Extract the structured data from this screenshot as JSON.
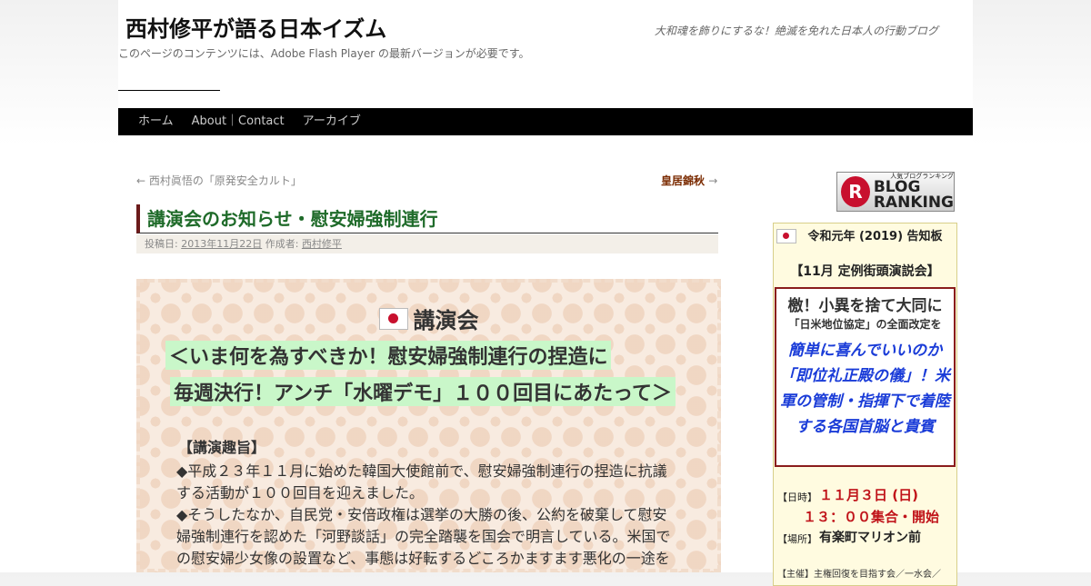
{
  "header": {
    "site_title": "西村修平が語る日本イズム",
    "tagline": "大和魂を飾りにするな！絶滅を免れた日本人の行動ブログ",
    "flash_note": "このページのコンテンツには、Adobe Flash Player の最新バージョンが必要です。"
  },
  "nav": {
    "items": [
      {
        "label": "ホーム"
      },
      {
        "label": "About｜Contact"
      },
      {
        "label": "アーカイブ"
      }
    ]
  },
  "post_nav": {
    "prev": "← 西村眞悟の「原発安全カルト」",
    "next": "皇居錦秋",
    "next_arrow": "→"
  },
  "post": {
    "title": "講演会のお知らせ・慰安婦強制連行",
    "meta_posted_label": "投稿日:",
    "meta_date": "2013年11月22日",
    "meta_author_label": "作成者:",
    "meta_author": "西村修平"
  },
  "content": {
    "heading": "講演会",
    "subtitle1": "＜いま何を為すべきか！慰安婦強制連行の捏造に",
    "subtitle2": "毎週決行！アンチ「水曜デモ」１００回目にあたって＞",
    "section_heading": "【講演趣旨】",
    "paragraphs": [
      "◆平成２３年１１月に始めた韓国大使館前で、慰安婦強制連行の捏造に抗議する活動が１００回目を迎えました。",
      "◆そうしたなか、自民党・安倍政権は選挙の大勝の後、公約を破棄して慰安婦強制連行を認めた「河野談話」の完全踏襲を国会で明言している。米国での慰安婦少女像の設置など、事態は好転するどころかますます悪化の一途を"
    ]
  },
  "banner": {
    "circle": "R",
    "small": "人気ブログランキング",
    "line1": "BLOG",
    "line2": "RANKING"
  },
  "sidebar": {
    "title": "令和元年 (2019) 告知板",
    "subtitle": "【11月 定例街頭演説会】",
    "box_line1": "檄！小異を捨て大同に",
    "box_line2": "「日米地位協定」の全面改定を",
    "box_blue": "簡単に喜んでいいのか「即位礼正殿の儀」！米軍の管制・指揮下で着陸する各国首脳と貴賓",
    "date_label": "【日時】",
    "date": "１１月３日 (日)",
    "time": "１３：００集合・開始",
    "place_label": "【場所】",
    "place": "有楽町マリオン前",
    "bottom": "【主催】主権回復を目指す会／一水会／"
  }
}
